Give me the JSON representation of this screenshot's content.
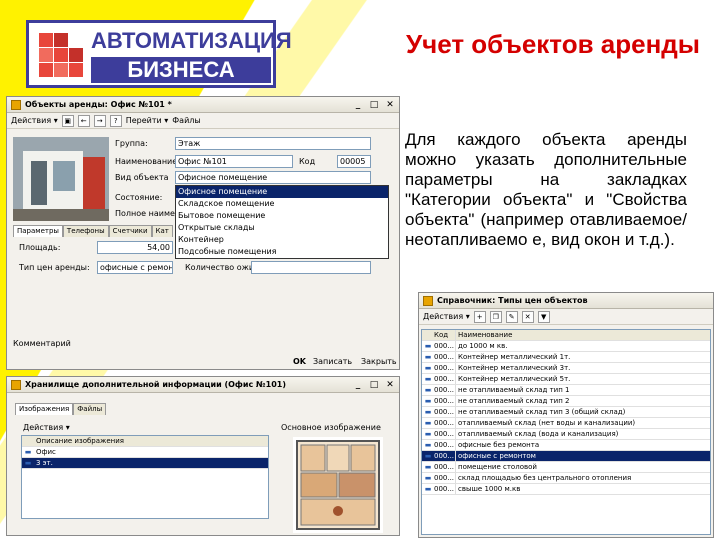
{
  "header": {
    "logo_line1": "АВТОМАТИЗАЦИЯ",
    "logo_line2": "БИЗНЕСА",
    "title": "Учет объектов аренды"
  },
  "description": "Для каждого объекта аренды можно указать дополнительные параметры на закладках \"Категории объекта\" и \"Свойства объекта\" (например отавливаемое/неотапливаемо е, вид окон и т.д.).",
  "object_window": {
    "title": "Объекты аренды: Офис №101 *",
    "toolbar": {
      "actions": "Действия ▾",
      "go": "Перейти ▾",
      "files": "Файлы"
    },
    "labels": {
      "group": "Группа:",
      "name": "Наименование",
      "type": "Вид объекта",
      "state": "Состояние:",
      "full_name": "Полное наиме-е",
      "code": "Код",
      "area": "Площадь:",
      "price_type": "Тип цен аренды:",
      "price_count": "Количество ожид",
      "comment": "Комментарий"
    },
    "values": {
      "group": "Этаж",
      "name": "Офис №101",
      "type": "Офисное помещение",
      "code": "00005",
      "area": "54,00",
      "price_type": "офисные с ремонт"
    },
    "dropdown_options": [
      "Офисное помещение",
      "Складское помещение",
      "Бытовое помещение",
      "Открытые склады",
      "Контейнер",
      "Подсобные помещения"
    ],
    "dropdown_selected_index": 0,
    "tabs": [
      "Параметры",
      "Телефоны",
      "Счетчики",
      "Кат"
    ],
    "buttons": {
      "ok": "OK",
      "save": "Записать",
      "close": "Закрыть"
    }
  },
  "storage_window": {
    "title": "Хранилище дополнительной информации (Офис №101)",
    "tabs": [
      "Изображения",
      "Файлы"
    ],
    "toolbar": {
      "actions": "Действия ▾"
    },
    "column_header": "Описание изображения",
    "main_image_label": "Основное изображение",
    "rows": [
      "Офис",
      "3 эт."
    ],
    "selected_row": 1
  },
  "price_window": {
    "title": "Справочник: Типы цен объектов",
    "toolbar": {
      "actions": "Действия ▾"
    },
    "headers": {
      "code": "Код",
      "name": "Наименование"
    },
    "rows": [
      {
        "code": "000...",
        "name": "до 1000 м кв."
      },
      {
        "code": "000...",
        "name": "Контейнер металлический 1т."
      },
      {
        "code": "000...",
        "name": "Контейнер металлический 3т."
      },
      {
        "code": "000...",
        "name": "Контейнер металлический 5т."
      },
      {
        "code": "000...",
        "name": "не отапливаемый склад тип 1"
      },
      {
        "code": "000...",
        "name": "не отапливаемый склад тип 2"
      },
      {
        "code": "000...",
        "name": "не отапливаемый склад тип 3 (общий склад)"
      },
      {
        "code": "000...",
        "name": "отапливаемый склад (нет воды и канализации)"
      },
      {
        "code": "000...",
        "name": "отапливаемый склад (вода и канализация)"
      },
      {
        "code": "000...",
        "name": "офисные без ремонта"
      },
      {
        "code": "000...",
        "name": "офисные с ремонтом"
      },
      {
        "code": "000...",
        "name": "помещение столовой"
      },
      {
        "code": "000...",
        "name": "склад площадью без центрального отопления"
      },
      {
        "code": "000...",
        "name": "свыше 1000 м.кв"
      }
    ],
    "selected_row": 10
  },
  "colors": {
    "title_red": "#d40000",
    "logo_blue": "#3d3d9b",
    "selection": "#0a246a",
    "stripe_yellow": "#fff200"
  }
}
